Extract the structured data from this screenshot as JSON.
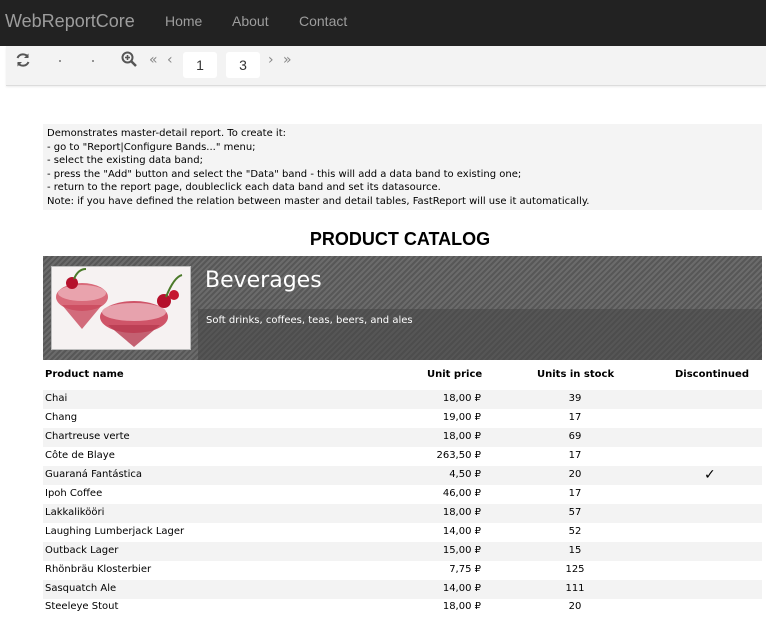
{
  "navbar": {
    "brand": "WebReportCore",
    "links": [
      "Home",
      "About",
      "Contact"
    ]
  },
  "toolbar": {
    "refresh_icon": "refresh-icon",
    "zoom_icon": "zoom-in-icon",
    "first_icon": "«",
    "prev_icon": "‹",
    "current_page": "1",
    "total_pages": "3",
    "next_icon": "›",
    "last_icon": "»"
  },
  "description": {
    "lines": [
      "Demonstrates master-detail report. To create it:",
      "- go to \"Report|Configure Bands...\" menu;",
      "- select the existing data band;",
      "- press the \"Add\" button and select the \"Data\" band - this will add a data band to existing one;",
      "- return to the report page, doubleclick each data band and set its datasource.",
      "Note: if you have defined the relation between master and detail tables, FastReport will use it automatically."
    ]
  },
  "report": {
    "title": "PRODUCT CATALOG",
    "category": {
      "name": "Beverages",
      "description": "Soft drinks, coffees, teas, beers, and ales"
    },
    "columns": [
      "Product name",
      "Unit price",
      "Units in stock",
      "Discontinued"
    ],
    "rows": [
      {
        "name": "Chai",
        "price": "18,00 ₽",
        "stock": "39",
        "discontinued": ""
      },
      {
        "name": "Chang",
        "price": "19,00 ₽",
        "stock": "17",
        "discontinued": ""
      },
      {
        "name": "Chartreuse verte",
        "price": "18,00 ₽",
        "stock": "69",
        "discontinued": ""
      },
      {
        "name": "Côte de Blaye",
        "price": "263,50 ₽",
        "stock": "17",
        "discontinued": ""
      },
      {
        "name": "Guaraná Fantástica",
        "price": "4,50 ₽",
        "stock": "20",
        "discontinued": "✓"
      },
      {
        "name": "Ipoh Coffee",
        "price": "46,00 ₽",
        "stock": "17",
        "discontinued": ""
      },
      {
        "name": "Lakkalikööri",
        "price": "18,00 ₽",
        "stock": "57",
        "discontinued": ""
      },
      {
        "name": "Laughing Lumberjack Lager",
        "price": "14,00 ₽",
        "stock": "52",
        "discontinued": ""
      },
      {
        "name": "Outback Lager",
        "price": "15,00 ₽",
        "stock": "15",
        "discontinued": ""
      },
      {
        "name": "Rhönbräu Klosterbier",
        "price": "7,75 ₽",
        "stock": "125",
        "discontinued": ""
      },
      {
        "name": "Sasquatch Ale",
        "price": "14,00 ₽",
        "stock": "111",
        "discontinued": ""
      },
      {
        "name": "Steeleye Stout",
        "price": "18,00 ₽",
        "stock": "20",
        "discontinued": ""
      }
    ]
  }
}
